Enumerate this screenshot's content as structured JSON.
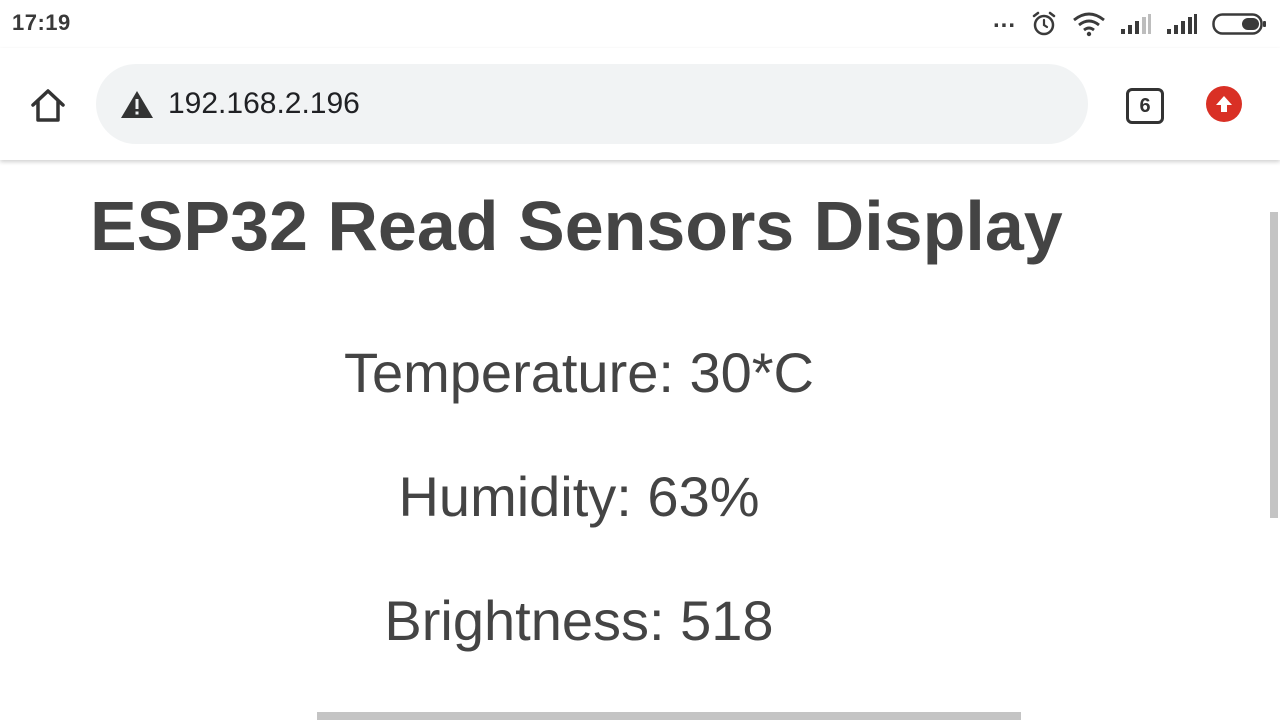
{
  "status_bar": {
    "time": "17:19",
    "icons": [
      "more-dots-icon",
      "alarm-icon",
      "wifi-icon",
      "signal-icon",
      "signal-icon",
      "battery-icon"
    ],
    "more_label": "..."
  },
  "browser": {
    "url": "192.168.2.196",
    "tab_count": "6",
    "icons": {
      "home": "home-icon",
      "security": "warning-icon",
      "update": "update-arrow-icon"
    },
    "colors": {
      "url_bar_bg": "#f1f3f4",
      "update_badge": "#d93025"
    }
  },
  "page": {
    "title": "ESP32 Read Sensors Display",
    "readings": {
      "temperature": "Temperature: 30*C",
      "humidity": "Humidity: 63%",
      "brightness": "Brightness: 518"
    }
  }
}
